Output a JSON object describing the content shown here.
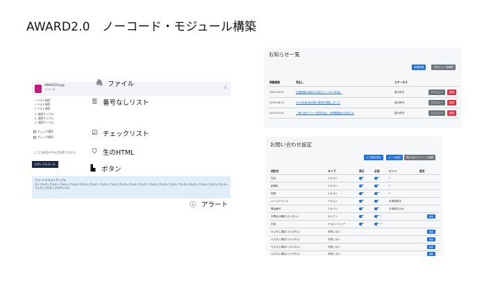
{
  "slide_title": "AWARD2.0　ノーコード・モジュール構築",
  "preview": {
    "file_name": "AWARD20.jpg",
    "file_size": "10.44 KB",
    "bullet_items": [
      "• リスト項目",
      "• リスト項目",
      "• リスト項目"
    ],
    "numbered_items": [
      "1. 項目サンプル",
      "2. 項目サンプル",
      "3. 項目サンプル"
    ],
    "checklist_items": [
      "チェック項目",
      "チェック項目"
    ],
    "html_text": "ここに自由なHTMLが記述できます。",
    "button_label": "ボタンテキスト",
    "alert_title": "アラートテキストサンプル",
    "alert_body": "サンプルサンプルサンプルサンプルサンプルサンプルサンプルサンプルサンプルサンプルサンプルサンプルサンプルサンプルサンプルサンプルサンプルサンプルサンプルサンプルサンプルサンプルサンプル"
  },
  "callouts": {
    "file": "ファイル",
    "numbered_list": "番号なしリスト",
    "checklist": "チェックリスト",
    "html": "生のHTML",
    "button": "ボタン",
    "alert": "アラート"
  },
  "notice": {
    "title": "お知らせ一覧",
    "btn_new": "新規投稿",
    "btn_list": "お知らせ一覧確認",
    "headers": [
      "掲載期間",
      "見出し",
      "ステータス"
    ],
    "rows": [
      {
        "date": "2025-05-01",
        "headline": "企業情報の更新のお知らせ（2025年版）",
        "status": "表示許可",
        "preview": "プレビュー",
        "delete": "削除"
      },
      {
        "date": "2025-06-15",
        "headline": "2024年度 論文集の発表を掲載しました",
        "status": "表示許可",
        "preview": "プレビュー",
        "delete": "削除"
      },
      {
        "date": "2025-07-01",
        "headline": "「第10回アワード受賞作品」の掲載開始のお知らせ",
        "status": "表示許可",
        "preview": "プレビュー",
        "delete": "削除"
      }
    ]
  },
  "contact": {
    "title": "お問い合わせ設定",
    "btn_add": "入力項目追加",
    "btn_mail": "メール設定",
    "btn_form": "問い合わせフォーム確認",
    "headers": [
      "項目名",
      "タイプ",
      "表示",
      "必須",
      "ヒント",
      "設定"
    ],
    "rows": [
      {
        "name": "氏名",
        "type": "テキスト",
        "required": true,
        "hint": "",
        "mark": "*"
      },
      {
        "name": "組織名",
        "type": "テキスト",
        "required": true,
        "hint": "",
        "mark": "*"
      },
      {
        "name": "所属",
        "type": "テキスト",
        "required": true,
        "hint": "",
        "mark": "*"
      },
      {
        "name": "メールアドレス",
        "type": "テキスト",
        "required": true,
        "hint": "半角英数字"
      },
      {
        "name": "電話番号",
        "type": "テキスト",
        "required": true,
        "hint": "半角数字のみ"
      },
      {
        "name": "お問合せ種別 (カスタム)",
        "type": "セレクト",
        "required": true,
        "mark": "*",
        "edit": "編集"
      },
      {
        "name": "内容",
        "type": "テキストエリア",
        "required": true,
        "mark": "*"
      },
      {
        "name": "カスタム項目1 (カスタム)",
        "type": "利用しない",
        "edit": "編集"
      },
      {
        "name": "カスタム項目2 (カスタム)",
        "type": "利用しない",
        "edit": "編集"
      },
      {
        "name": "カスタム項目3 (カスタム)",
        "type": "利用しない",
        "edit": "編集"
      },
      {
        "name": "カスタム項目4 (カスタム)",
        "type": "利用しない",
        "edit": "編集"
      }
    ]
  }
}
